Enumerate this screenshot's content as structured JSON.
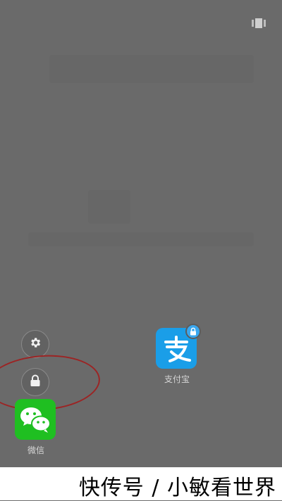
{
  "apps": [
    {
      "name": "支付宝",
      "icon": "alipay-icon",
      "locked": true,
      "color": "#1a9ee8"
    },
    {
      "name": "微信",
      "icon": "wechat-icon",
      "locked": false,
      "color": "#1fbf21"
    }
  ],
  "controls": {
    "settings_icon": "gear-icon",
    "lock_icon": "lock-icon",
    "recents_icon": "recent-apps-icon"
  },
  "annotation": {
    "color": "#9c2424"
  },
  "watermark": {
    "text": "快传号 / 小敏看世界"
  }
}
